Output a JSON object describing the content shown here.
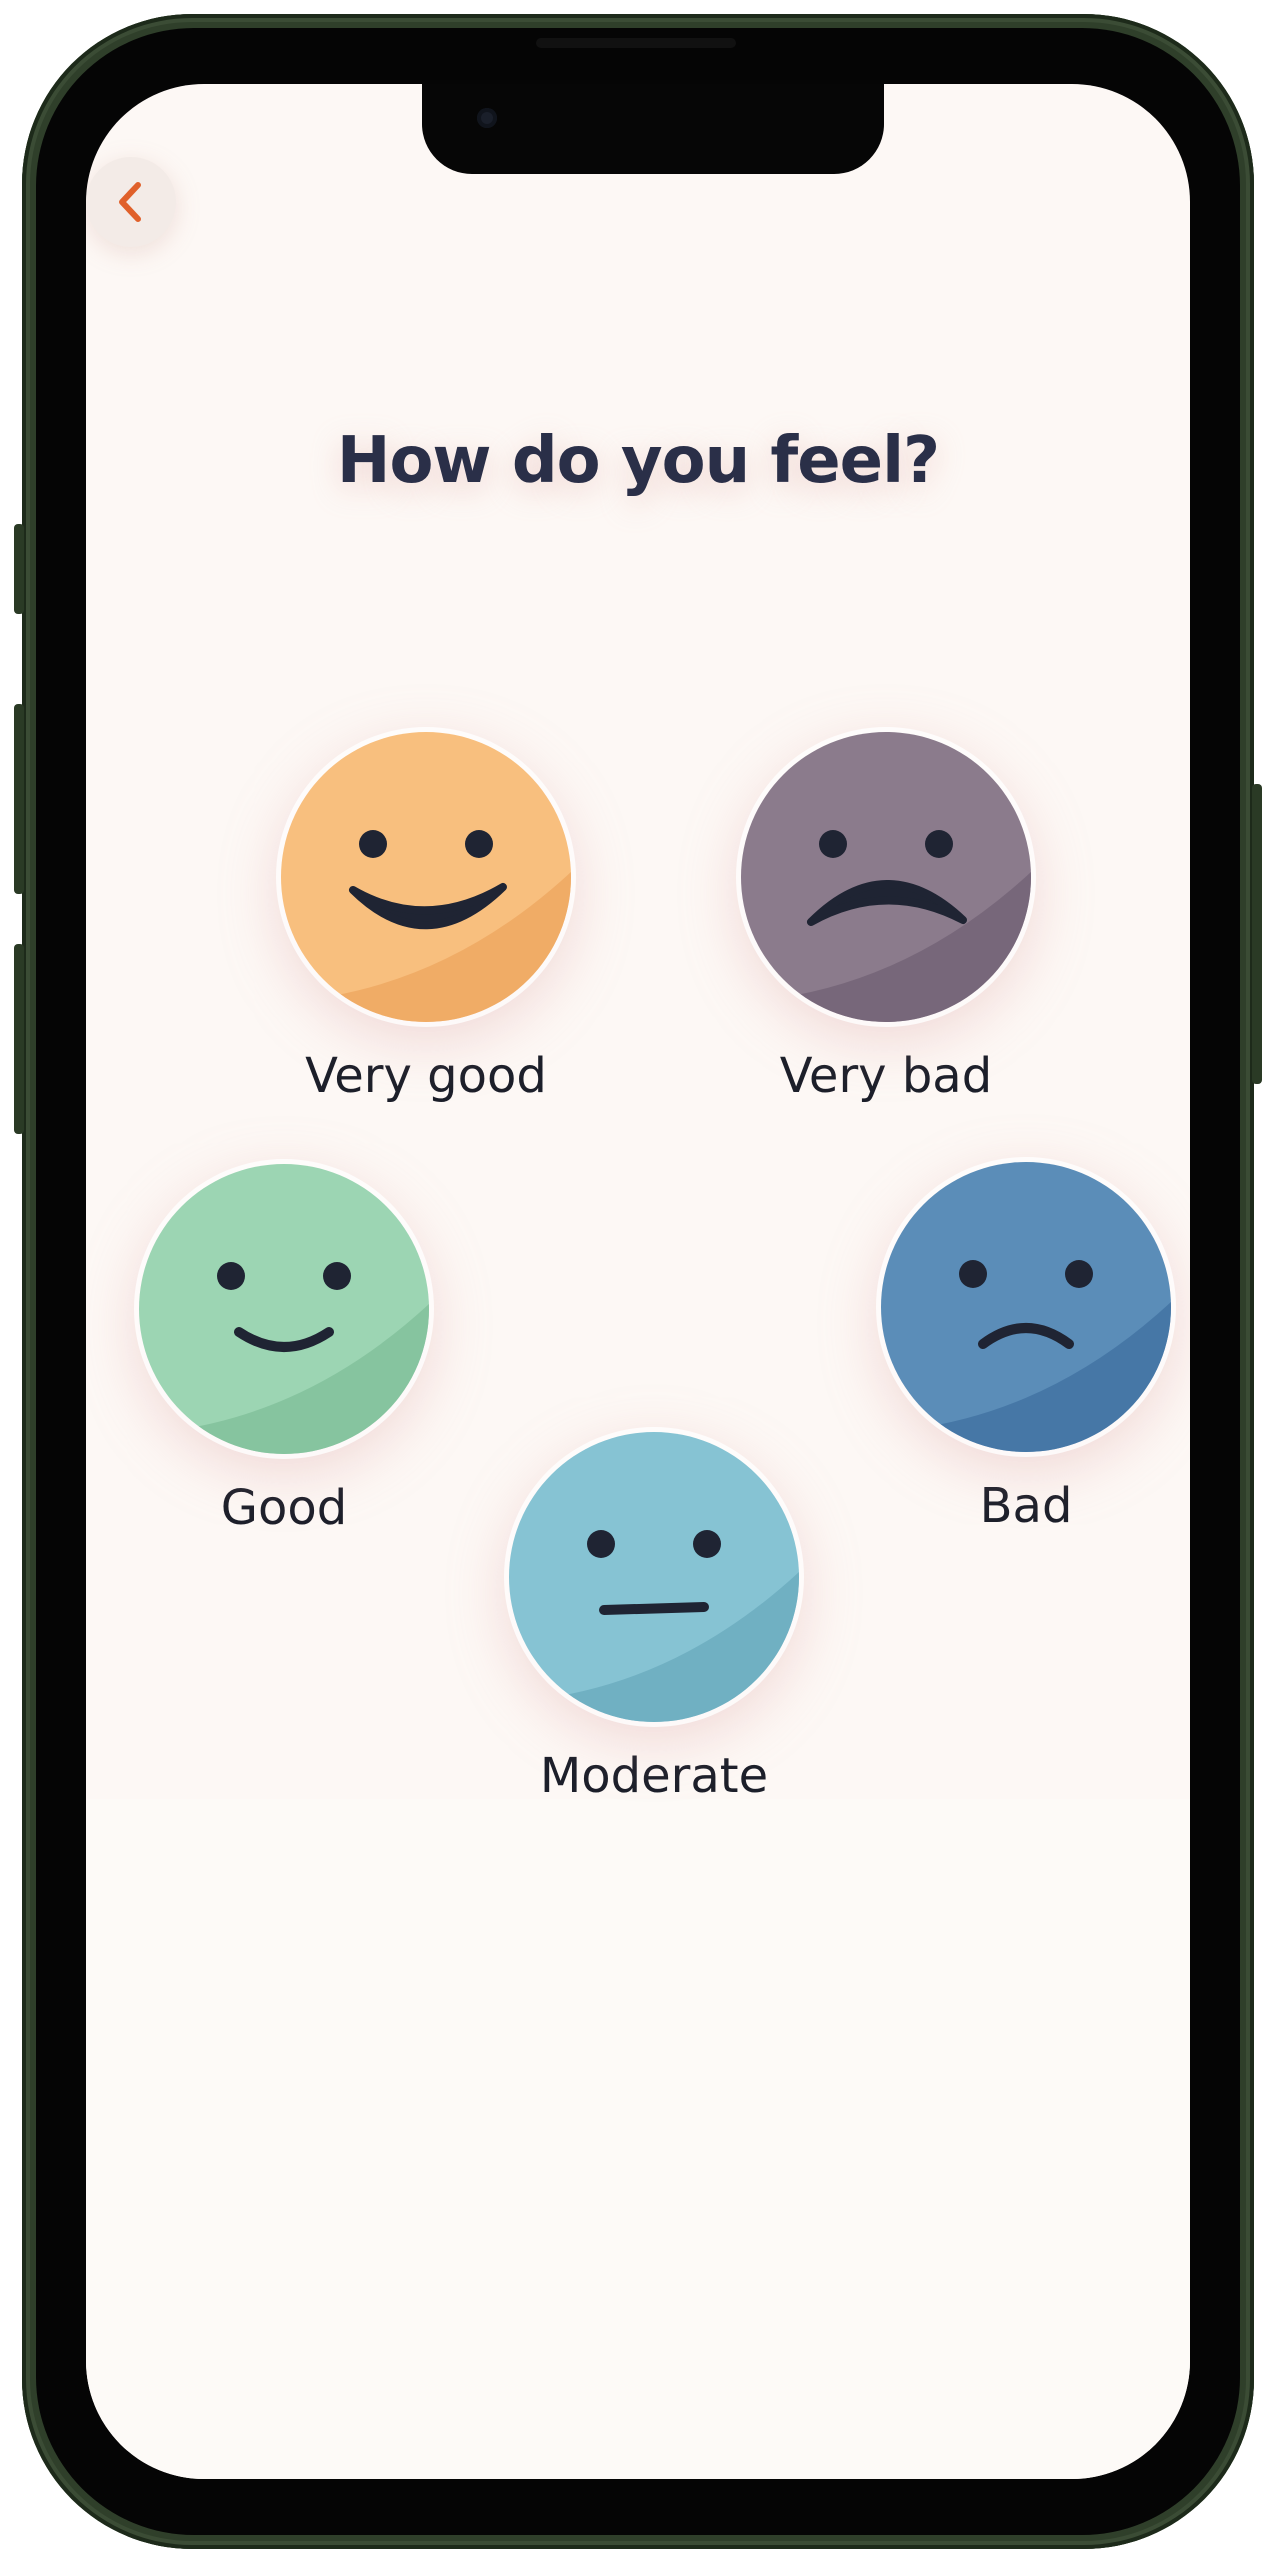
{
  "screen": {
    "title": "How do you feel?"
  },
  "colors": {
    "accent": "#e0602a",
    "title": "#2a2f48",
    "background": "#fdf8f5",
    "very_good": "#f8bf7e",
    "very_bad": "#8b7b8c",
    "good": "#9cd5b3",
    "bad": "#5b8db8",
    "moderate": "#86c3d3"
  },
  "moods": [
    {
      "id": "very-good",
      "label": "Very good",
      "expression": "big-smile"
    },
    {
      "id": "very-bad",
      "label": "Very bad",
      "expression": "big-frown"
    },
    {
      "id": "good",
      "label": "Good",
      "expression": "smile"
    },
    {
      "id": "bad",
      "label": "Bad",
      "expression": "frown"
    },
    {
      "id": "moderate",
      "label": "Moderate",
      "expression": "neutral"
    }
  ],
  "icons": {
    "back": "chevron-left-icon"
  }
}
